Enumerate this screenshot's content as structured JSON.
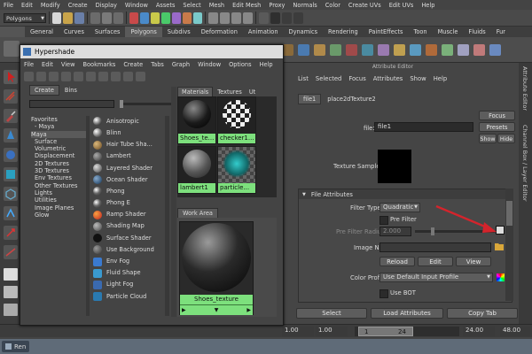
{
  "app": {
    "menu": [
      "File",
      "Edit",
      "Modify",
      "Create",
      "Display",
      "Window",
      "Assets",
      "Select",
      "Mesh",
      "Edit Mesh",
      "Proxy",
      "Normals",
      "Color",
      "Create UVs",
      "Edit UVs",
      "Help"
    ],
    "mode_select": "Polygons",
    "shelf_tabs": [
      "General",
      "Curves",
      "Surfaces",
      "Polygons",
      "Subdivs",
      "Deformation",
      "Animation",
      "Dynamics",
      "Rendering",
      "PaintEffects",
      "Toon",
      "Muscle",
      "Fluids",
      "Fur"
    ],
    "active_shelf_tab": "Polygons",
    "side_tabs": [
      "Attribute Editor",
      "Channel Box / Layer Editor"
    ]
  },
  "hypershade": {
    "title": "Hypershade",
    "menu": [
      "File",
      "Edit",
      "View",
      "Bookmarks",
      "Create",
      "Tabs",
      "Graph",
      "Window",
      "Options",
      "Help"
    ],
    "left_tabs": [
      "Create",
      "Bins"
    ],
    "tree": [
      "Favorites",
      "- Maya",
      "Maya",
      "Surface",
      "Volumetric",
      "Displacement",
      "2D Textures",
      "3D Textures",
      "Env Textures",
      "Other Textures",
      "Lights",
      "Utilities",
      "Image Planes",
      "Glow"
    ],
    "nodes": [
      "Anisotropic",
      "Blinn",
      "Hair Tube Sha...",
      "Lambert",
      "Layered Shader",
      "Ocean Shader",
      "Phong",
      "Phong E",
      "Ramp Shader",
      "Shading Map",
      "Surface Shader",
      "Use Background",
      "Env Fog",
      "Fluid Shape",
      "Light Fog",
      "Particle Cloud"
    ],
    "top_tabs": [
      "Materials",
      "Textures",
      "Ut"
    ],
    "swatches": [
      "Shoes_te...",
      "checker1...",
      "lambert1",
      "particle..."
    ],
    "work_area_tab": "Work Area",
    "work_node": "Shoes_texture"
  },
  "attr_editor": {
    "title": "Attribute Editor",
    "menu": [
      "List",
      "Selected",
      "Focus",
      "Attributes",
      "Show",
      "Help"
    ],
    "tabs": [
      "file1",
      "place2dTexture2"
    ],
    "file_label": "file:",
    "file_value": "file1",
    "focus_btn": "Focus",
    "presets_btn": "Presets",
    "show_btn": "Show",
    "hide_btn": "Hide",
    "texture_sample_label": "Texture Sample",
    "section_title": "File Attributes",
    "filter_type_label": "Filter Type",
    "filter_type_value": "Quadratic",
    "pre_filter_label": "Pre Filter",
    "pre_filter_radius_label": "Pre Filter Radius",
    "pre_filter_radius_value": "2.000",
    "image_name_label": "Image Name",
    "reload_btn": "Reload",
    "edit_btn": "Edit",
    "view_btn": "View",
    "color_profile_label": "Color Profile",
    "color_profile_value": "Use Default Input Profile",
    "use_bot_label": "Use BOT",
    "select_btn": "Select",
    "load_attributes_btn": "Load Attributes",
    "copy_tab_btn": "Copy Tab"
  },
  "timeline": {
    "start": "1.00",
    "range_start_a": "1.00",
    "range_start_b": "1",
    "range_end": "24",
    "end_a": "24.00",
    "end_b": "48.00"
  },
  "taskbar_label": "Ren",
  "colors": {
    "arrow": "#d4242c",
    "swatch_caption": "#7de07d"
  }
}
